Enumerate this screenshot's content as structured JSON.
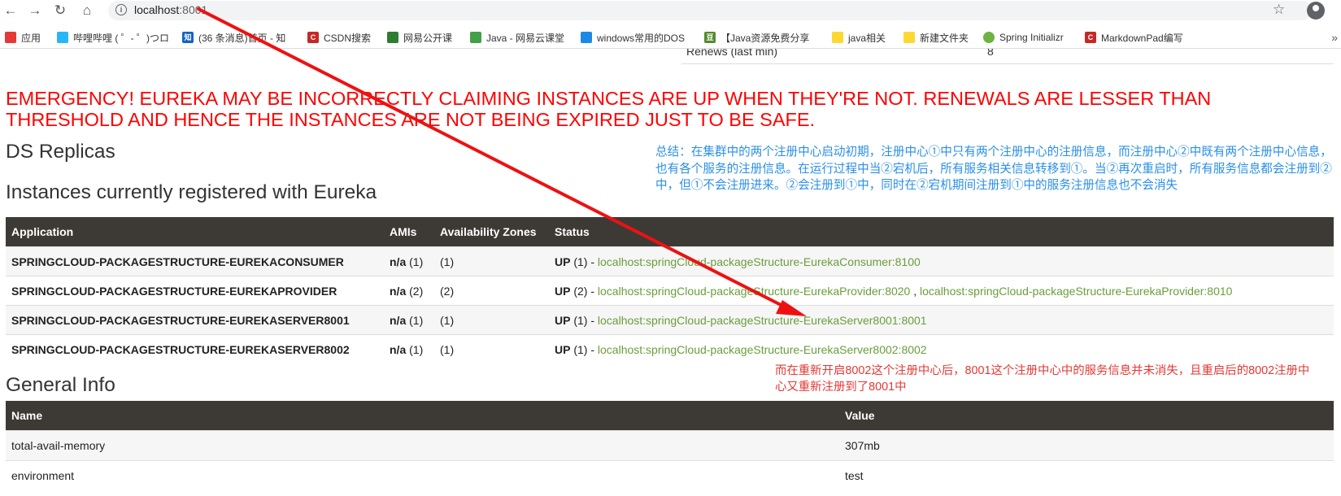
{
  "browser": {
    "url_host": "localhost",
    "url_port": ":8001",
    "bookmarks": [
      {
        "label": "应用",
        "color": "#e53935"
      },
      {
        "label": "哔哩哔哩 ( ゜- ゜)つロ",
        "color": "#29b6f6"
      },
      {
        "label": "(36 条消息)首页 - 知",
        "color": "#1565c0"
      },
      {
        "label": "CSDN搜索",
        "color": "#c62828"
      },
      {
        "label": "网易公开课",
        "color": "#2e7d32"
      },
      {
        "label": "Java - 网易云课堂",
        "color": "#43a047"
      },
      {
        "label": "windows常用的DOS",
        "color": "#1e88e5"
      },
      {
        "label": "【Java资源免费分享",
        "color": "#558b2f"
      },
      {
        "label": "java相关",
        "color": "#fdd835"
      },
      {
        "label": "新建文件夹",
        "color": "#fdd835"
      },
      {
        "label": "Spring Initializr",
        "color": "#6db33f"
      },
      {
        "label": "MarkdownPad编写",
        "color": "#c62828"
      }
    ]
  },
  "page": {
    "renews_label": "Renews (last min)",
    "renews_value": "8",
    "emergency": "EMERGENCY! EUREKA MAY BE INCORRECTLY CLAIMING INSTANCES ARE UP WHEN THEY'RE NOT. RENEWALS ARE LESSER THAN THRESHOLD AND HENCE THE INSTANCES ARE NOT BEING EXPIRED JUST TO BE SAFE.",
    "ds_replicas": "DS Replicas",
    "instances_title": "Instances currently registered with Eureka",
    "general_title": "General Info",
    "note_blue": "总结：在集群中的两个注册中心启动初期，注册中心①中只有两个注册中心的注册信息，而注册中心②中既有两个注册中心信息，也有各个服务的注册信息。在运行过程中当②宕机后，所有服务相关信息转移到①。当②再次重启时，所有服务信息都会注册到②中，但①不会注册进来。②会注册到①中，同时在②宕机期间注册到①中的服务注册信息也不会消失",
    "note_red": "而在重新开启8002这个注册中心后，8001这个注册中心中的服务信息并未消失，且重启后的8002注册中心又重新注册到了8001中"
  },
  "instances": {
    "headers": [
      "Application",
      "AMIs",
      "Availability Zones",
      "Status"
    ],
    "rows": [
      {
        "app": "SPRINGCLOUD-PACKAGESTRUCTURE-EUREKACONSUMER",
        "amis": "n/a",
        "amis_count": "(1)",
        "az": "(1)",
        "status": "UP",
        "status_count": "(1) - ",
        "links": [
          "localhost:springCloud-packageStructure-EurekaConsumer:8100"
        ]
      },
      {
        "app": "SPRINGCLOUD-PACKAGESTRUCTURE-EUREKAPROVIDER",
        "amis": "n/a",
        "amis_count": "(2)",
        "az": "(2)",
        "status": "UP",
        "status_count": "(2) - ",
        "links": [
          "localhost:springCloud-packageStructure-EurekaProvider:8020",
          "localhost:springCloud-packageStructure-EurekaProvider:8010"
        ]
      },
      {
        "app": "SPRINGCLOUD-PACKAGESTRUCTURE-EUREKASERVER8001",
        "amis": "n/a",
        "amis_count": "(1)",
        "az": "(1)",
        "status": "UP",
        "status_count": "(1) - ",
        "links": [
          "localhost:springCloud-packageStructure-EurekaServer8001:8001"
        ]
      },
      {
        "app": "SPRINGCLOUD-PACKAGESTRUCTURE-EUREKASERVER8002",
        "amis": "n/a",
        "amis_count": "(1)",
        "az": "(1)",
        "status": "UP",
        "status_count": "(1) - ",
        "links": [
          "localhost:springCloud-packageStructure-EurekaServer8002:8002"
        ]
      }
    ]
  },
  "general": {
    "headers": [
      "Name",
      "Value"
    ],
    "rows": [
      {
        "name": "total-avail-memory",
        "value": "307mb"
      },
      {
        "name": "environment",
        "value": "test"
      }
    ]
  },
  "colors": {
    "emergency": "#ff0000",
    "table_header": "#3d3a35",
    "link": "#6a9e3c",
    "note_blue": "#2a8fe6",
    "note_red": "#e53935",
    "arrow": "#ee1111"
  }
}
